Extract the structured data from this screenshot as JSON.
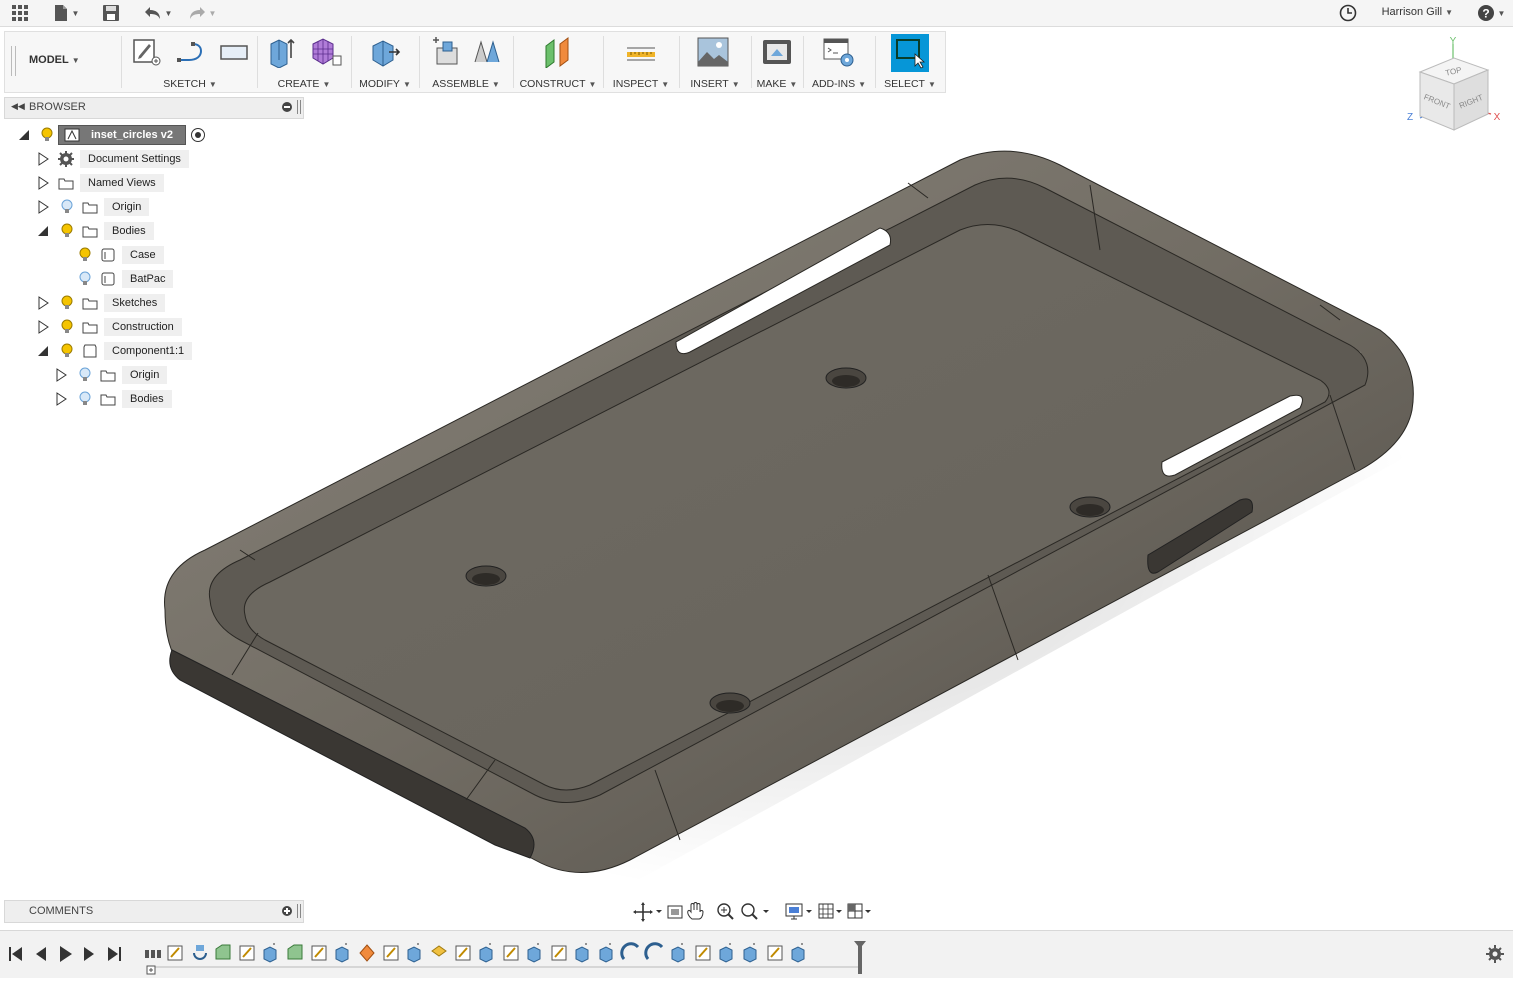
{
  "appbar": {
    "user_name": "Harrison Gill",
    "icons": [
      "apps-grid-icon",
      "file-icon",
      "save-icon",
      "undo-icon",
      "redo-icon",
      "job-status-icon",
      "help-icon"
    ]
  },
  "toolbar": {
    "workspace": "MODEL",
    "groups": [
      {
        "label": "SKETCH"
      },
      {
        "label": "CREATE"
      },
      {
        "label": "MODIFY"
      },
      {
        "label": "ASSEMBLE"
      },
      {
        "label": "CONSTRUCT"
      },
      {
        "label": "INSPECT"
      },
      {
        "label": "INSERT"
      },
      {
        "label": "MAKE"
      },
      {
        "label": "ADD-INS"
      },
      {
        "label": "SELECT"
      }
    ]
  },
  "viewcube": {
    "top": "TOP",
    "front": "FRONT",
    "right": "RIGHT",
    "axis_x": "X",
    "axis_y": "Y",
    "axis_z": "Z"
  },
  "browser": {
    "title": "BROWSER",
    "root": "inset_circles v2",
    "items": [
      {
        "label": "Document Settings"
      },
      {
        "label": "Named Views"
      },
      {
        "label": "Origin"
      },
      {
        "label": "Bodies"
      },
      {
        "label": "Case"
      },
      {
        "label": "BatPac"
      },
      {
        "label": "Sketches"
      },
      {
        "label": "Construction"
      },
      {
        "label": "Component1:1"
      },
      {
        "label": "Origin"
      },
      {
        "label": "Bodies"
      }
    ]
  },
  "comments": {
    "title": "COMMENTS"
  },
  "colors": {
    "select_active": "#0696d7",
    "body": "#6f6b63",
    "bulb_on": "#f5c400",
    "bulb_off": "#6aa3d8"
  }
}
